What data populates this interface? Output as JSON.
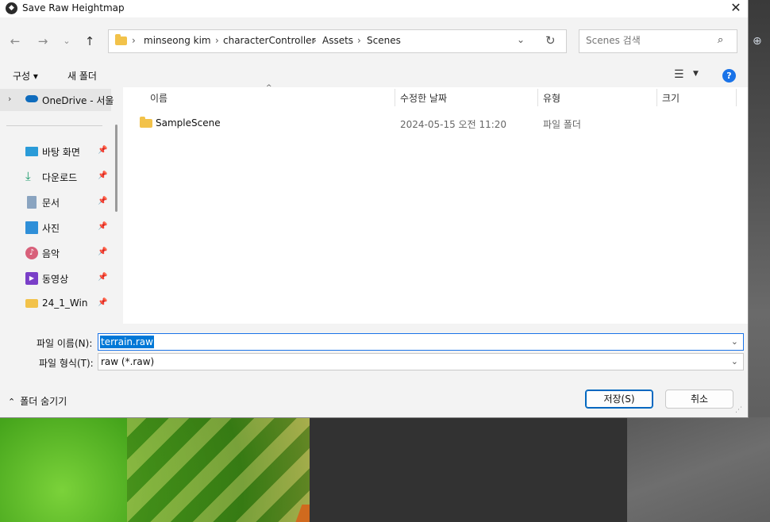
{
  "window": {
    "title": "Save Raw Heightmap"
  },
  "address": {
    "crumbs": [
      "minseong kim",
      "characterController",
      "Assets",
      "Scenes"
    ],
    "separator": "›"
  },
  "search": {
    "placeholder": "Scenes 검색"
  },
  "toolbar": {
    "organize": "구성 ▾",
    "new_folder": "새 폴더",
    "help": "?"
  },
  "sidebar": {
    "onedrive": "OneDrive - 서울",
    "items": [
      {
        "label": "바탕 화면",
        "icon": "desktop-icon"
      },
      {
        "label": "다운로드",
        "icon": "download-icon"
      },
      {
        "label": "문서",
        "icon": "document-icon"
      },
      {
        "label": "사진",
        "icon": "pictures-icon"
      },
      {
        "label": "음악",
        "icon": "music-icon"
      },
      {
        "label": "동영상",
        "icon": "video-icon"
      },
      {
        "label": "24_1_Win",
        "icon": "folder-icon"
      }
    ]
  },
  "list": {
    "columns": [
      "이름",
      "수정한 날짜",
      "유형",
      "크기"
    ],
    "rows": [
      {
        "name": "SampleScene",
        "modified": "2024-05-15 오전 11:20",
        "type": "파일 폴더",
        "size": ""
      }
    ]
  },
  "form": {
    "filename_label": "파일 이름(N):",
    "filename_value": "terrain.raw",
    "filetype_label": "파일 형식(T):",
    "filetype_value": "raw (*.raw)"
  },
  "footer": {
    "hide_folders": "폴더 숨기기",
    "save": "저장(S)",
    "cancel": "취소"
  },
  "colors": {
    "accent": "#0067c0",
    "selection": "#0078d7",
    "folder": "#f2c24a"
  }
}
